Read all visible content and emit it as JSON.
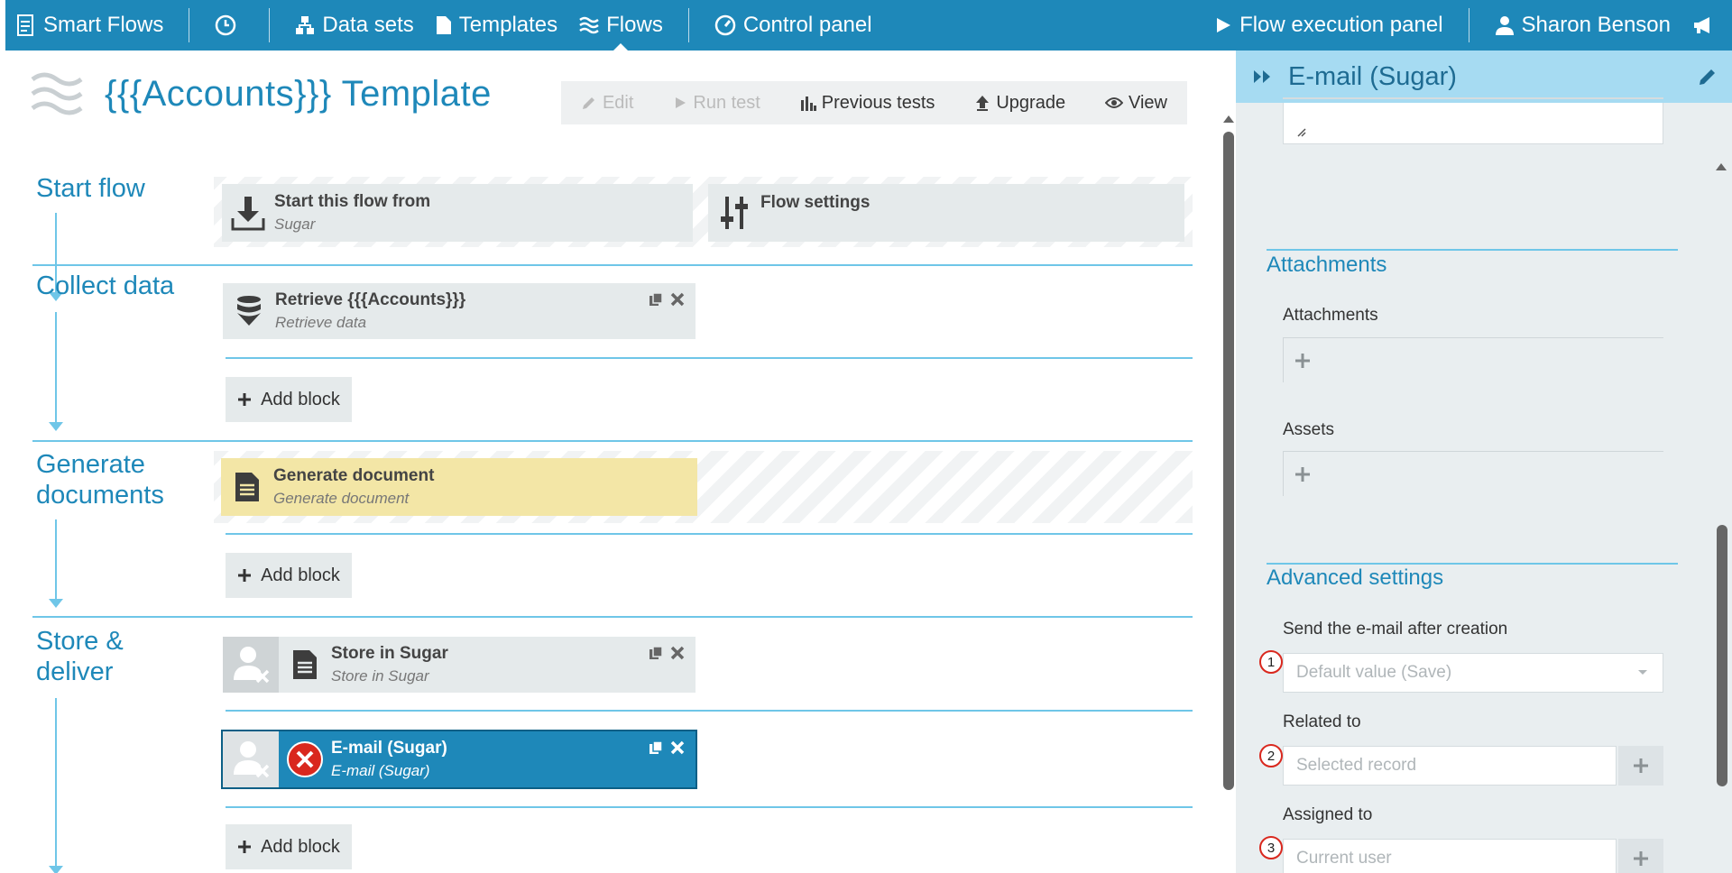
{
  "nav": {
    "brand": "Smart Flows",
    "datasets": "Data sets",
    "templates": "Templates",
    "flows": "Flows",
    "control_panel": "Control panel",
    "flow_exec": "Flow execution panel",
    "user": "Sharon Benson"
  },
  "page": {
    "title": "{{{Accounts}}} Template"
  },
  "toolbar": {
    "edit": "Edit",
    "run_test": "Run test",
    "previous_tests": "Previous tests",
    "upgrade": "Upgrade",
    "view": "View"
  },
  "sections": {
    "start_flow": "Start flow",
    "collect_data": "Collect data",
    "generate_documents_1": "Generate",
    "generate_documents_2": "documents",
    "store_deliver_1": "Store &",
    "store_deliver_2": "deliver"
  },
  "blocks": {
    "start_from_title": "Start this flow from",
    "start_from_sub": "Sugar",
    "flow_settings_title": "Flow settings",
    "retrieve_title": "Retrieve {{{Accounts}}}",
    "retrieve_sub": "Retrieve data",
    "generate_title": "Generate document",
    "generate_sub": "Generate document",
    "store_title": "Store in Sugar",
    "store_sub": "Store in Sugar",
    "email_title": "E-mail (Sugar)",
    "email_sub": "E-mail (Sugar)",
    "add_block": "Add block"
  },
  "panel": {
    "title": "E-mail (Sugar)",
    "attachments_section": "Attachments",
    "attachments_label": "Attachments",
    "assets_label": "Assets",
    "advanced_section": "Advanced settings",
    "send_label": "Send the e-mail after creation",
    "send_value": "Default value (Save)",
    "related_label": "Related to",
    "related_placeholder": "Selected record",
    "assigned_label": "Assigned to",
    "assigned_placeholder": "Current user",
    "num1": "1",
    "num2": "2",
    "num3": "3"
  },
  "colors": {
    "primary": "#1e88b9",
    "panel_header": "#a6dbf2",
    "highlight_yellow": "#f3e6a6",
    "error_red": "#d9281e"
  }
}
